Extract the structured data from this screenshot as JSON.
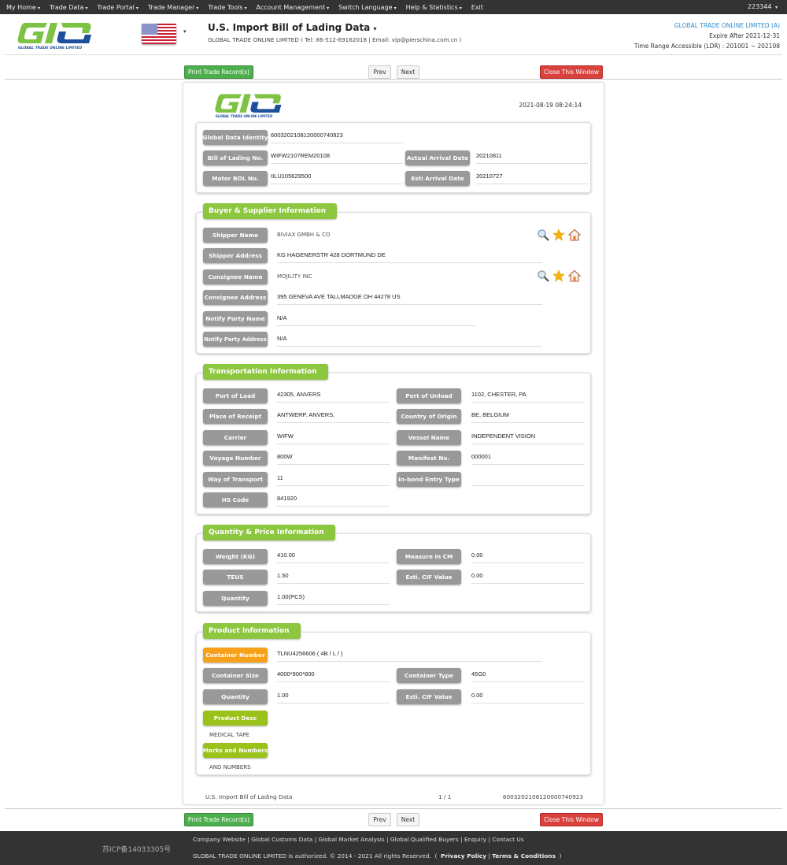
{
  "topnav": {
    "items": [
      "My Home",
      "Trade Data",
      "Trade Portal",
      "Trade Manager",
      "Trade Tools",
      "Account Management",
      "Switch Language",
      "Help & Statistics",
      "Exit"
    ],
    "user": "223344"
  },
  "header": {
    "logo_text": "GLOBAL TRADE ONLINE LIMITED",
    "title": "U.S. Import Bill of Lading Data",
    "subtitle": "GLOBAL TRADE ONLINE LIMITED ( Tel: 86-512-69162018 | Email: vip@pierschina.com.cn )",
    "company": "GLOBAL TRADE ONLINE LIMITED (A)",
    "expire": "Expire After 2021-12-31",
    "time_range": "Time Range Accessible (LDR) : 201001 ~ 202108"
  },
  "toolbar": {
    "print": "Print Trade Record(s)",
    "prev": "Prev",
    "next": "Next",
    "close": "Close This Window"
  },
  "doc": {
    "timestamp": "2021-08-19 08:24:14",
    "identity": {
      "global_data_identity_label": "Global Data Identity",
      "global_data_identity": "6003202108120000740923",
      "bol_label": "Bill of Lading No.",
      "bol": "WIFW2107REM20108",
      "actual_arrival_label": "Actual Arrival Date",
      "actual_arrival": "20210811",
      "master_bol_label": "Mater BOL No.",
      "master_bol": "IILU105629500",
      "esti_arrival_label": "Esti Arrival Date",
      "esti_arrival": "20210727"
    },
    "buyer_supplier": {
      "title": "Buyer & Supplier Information",
      "rows": [
        {
          "label": "Shipper Name",
          "value": "BIVIAX GMBH & CO"
        },
        {
          "label": "Shipper Address",
          "value": "KG HAGENERSTR 428 DORTMUND DE"
        },
        {
          "label": "Consignee Name",
          "value": "MOJILITY INC"
        },
        {
          "label": "Consignee Address",
          "value": "395 GENEVA AVE TALLMADGE OH 44278 US"
        },
        {
          "label": "Notify Party Name",
          "value": "N/A"
        },
        {
          "label": "Notify Party Address",
          "value": "N/A"
        }
      ]
    },
    "transport": {
      "title": "Transportation Information",
      "rows": [
        {
          "label": "Port of Load",
          "value": "42305, ANVERS",
          "label2": "Port of Unload",
          "value2": "1102, CHESTER, PA"
        },
        {
          "label": "Place of Receipt",
          "value": "ANTWERP. ANVERS,",
          "label2": "Country of Origin",
          "value2": "BE, BELGIUM"
        },
        {
          "label": "Carrier",
          "value": "WIFW",
          "label2": "Vessel Name",
          "value2": "INDEPENDENT VISION"
        },
        {
          "label": "Voyage Number",
          "value": "800W",
          "label2": "Manifest No.",
          "value2": "000001"
        },
        {
          "label": "Way of Transport",
          "value": "11",
          "label2": "In-bond Entry Type",
          "value2": ""
        },
        {
          "label": "HS Code",
          "value": "841920"
        }
      ]
    },
    "quantity": {
      "title": "Quantity & Price Information",
      "rows": [
        {
          "label": "Weight (KG)",
          "value": "410.00",
          "label2": "Measure in CM",
          "value2": "0.00"
        },
        {
          "label": "TEUS",
          "value": "1.50",
          "label2": "Esti. CIF Value",
          "value2": "0.00"
        },
        {
          "label": "Quantity",
          "value": "1.00(PCS)"
        }
      ]
    },
    "product": {
      "title": "Product Information",
      "container_number_label": "Container Number",
      "container_number": "TLNU4256606 ( 4B / L /  )",
      "container_size_label": "Container Size",
      "container_size": "4000*900*800",
      "container_type_label": "Container Type",
      "container_type": "45G0",
      "quantity_label": "Quantity",
      "quantity": "1.00",
      "cif_label": "Esti. CIF Value",
      "cif": "0.00",
      "desc_label": "Product Desc",
      "desc": "MEDICAL TAPE",
      "marks_label": "Marks and Numbers",
      "marks": "AND NUMBERS"
    },
    "footer": {
      "name": "U.S. Import Bill of Lading Data",
      "page": "1 / 1",
      "id": "6003202108120000740923"
    }
  },
  "footer": {
    "icp": "苏ICP备14033305号",
    "links": [
      "Company Website",
      "Global Customs Data",
      "Global Market Analysis",
      "Global Qualified Buyers",
      "Enquiry",
      "Contact Us"
    ],
    "copyright": "GLOBAL TRADE ONLINE LIMITED is authorized. © 2014 - 2021 All rights Reserved.",
    "privacy": "Privacy Policy",
    "terms": "Terms & Conditions"
  }
}
